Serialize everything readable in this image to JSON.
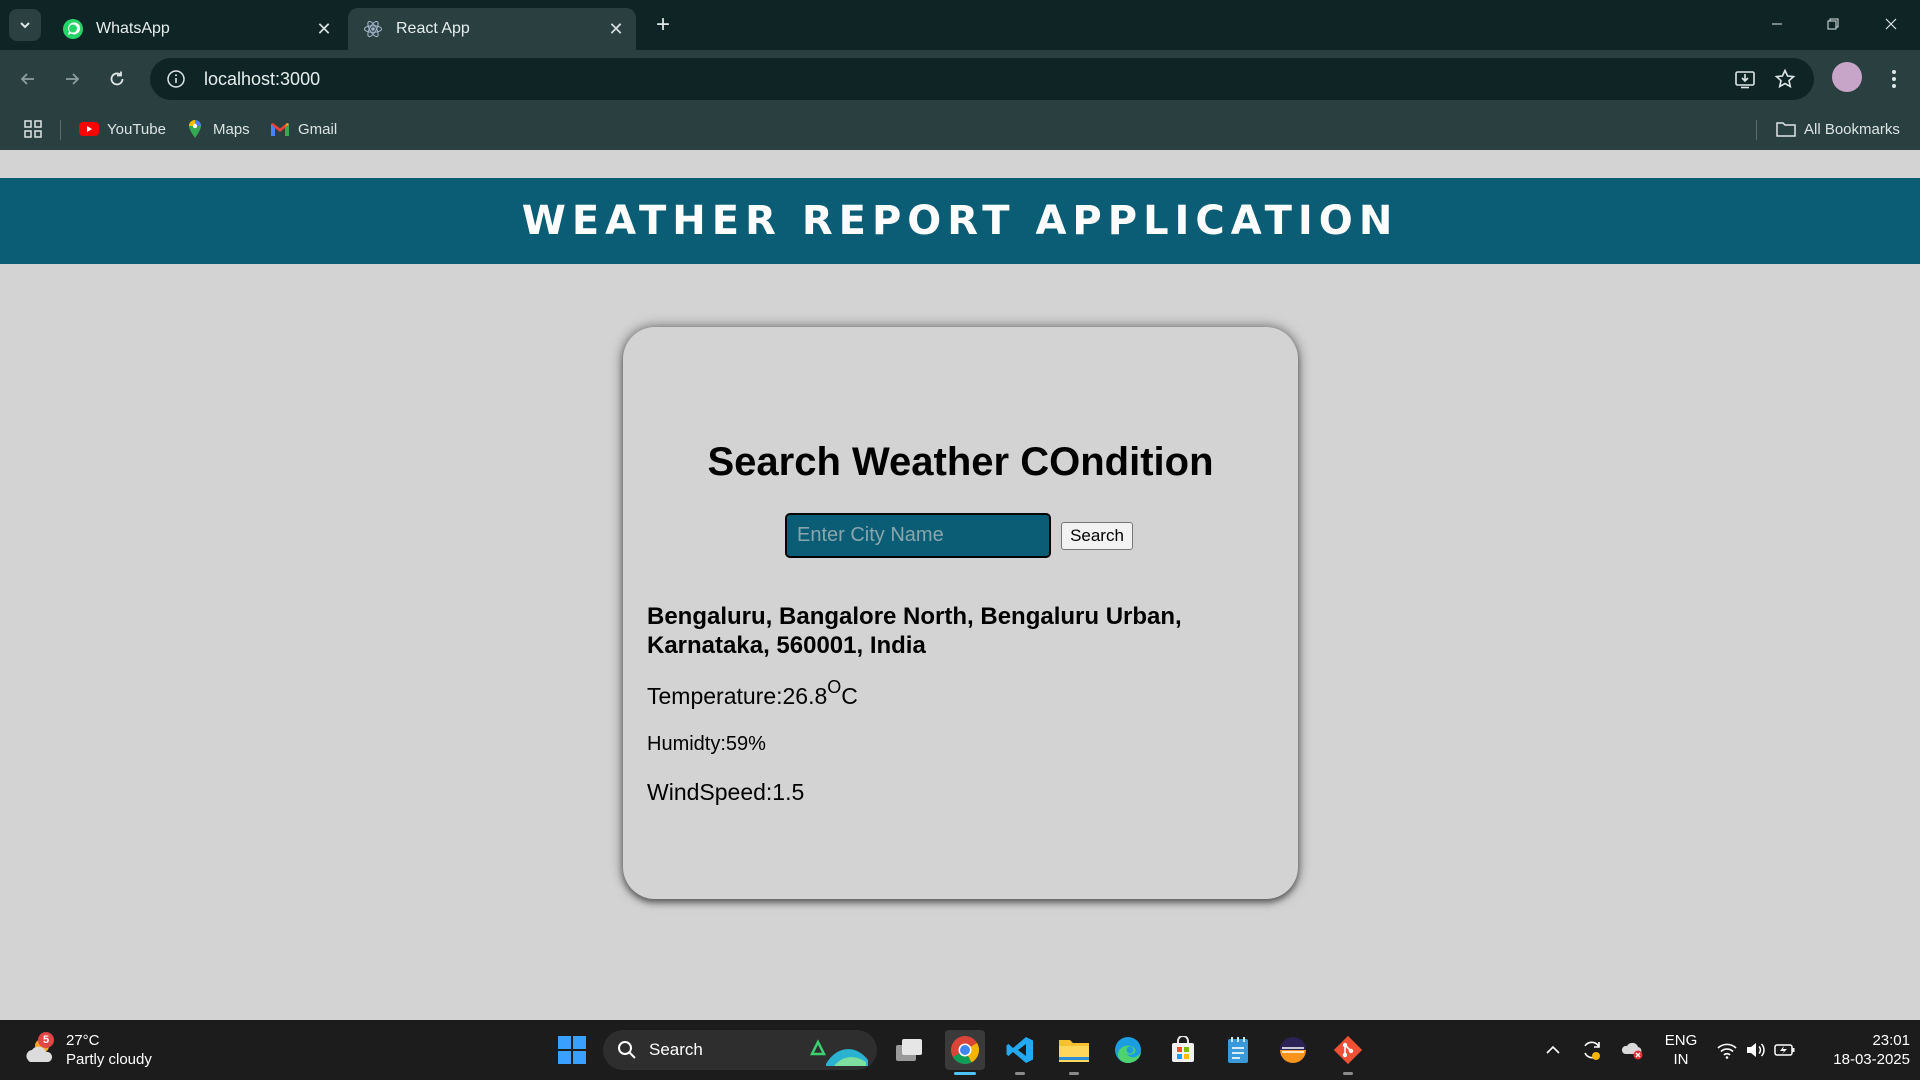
{
  "browser": {
    "tabs": [
      {
        "title": "WhatsApp",
        "active": false,
        "favicon": "whatsapp-icon"
      },
      {
        "title": "React App",
        "active": true,
        "favicon": "react-icon"
      }
    ],
    "url": "localhost:3000",
    "bookmarks": [
      {
        "label": "YouTube",
        "icon": "youtube-icon"
      },
      {
        "label": "Maps",
        "icon": "maps-icon"
      },
      {
        "label": "Gmail",
        "icon": "gmail-icon"
      }
    ],
    "all_bookmarks_label": "All Bookmarks"
  },
  "app": {
    "header_title": "WEATHER REPORT APPLICATION",
    "card_title": "Search Weather COndition",
    "search": {
      "placeholder": "Enter City Name",
      "value": "",
      "button_label": "Search"
    },
    "result": {
      "location": "Bengaluru, Bangalore North, Bengaluru Urban, Karnataka, 560001, India",
      "temperature_label": "Temperature:",
      "temperature_value": "26.8",
      "temperature_degree": "O",
      "temperature_unit": "C",
      "humidity": "Humidty:59%",
      "windspeed": "WindSpeed:1.5"
    },
    "colors": {
      "header_bg": "#0a5d74",
      "page_bg": "#d3d3d3",
      "input_bg": "#0a5d74"
    }
  },
  "taskbar": {
    "weather_badge": "5",
    "weather_temp": "27°C",
    "weather_desc": "Partly cloudy",
    "search_label": "Search",
    "lang_line1": "ENG",
    "lang_line2": "IN",
    "time": "23:01",
    "date": "18-03-2025"
  }
}
